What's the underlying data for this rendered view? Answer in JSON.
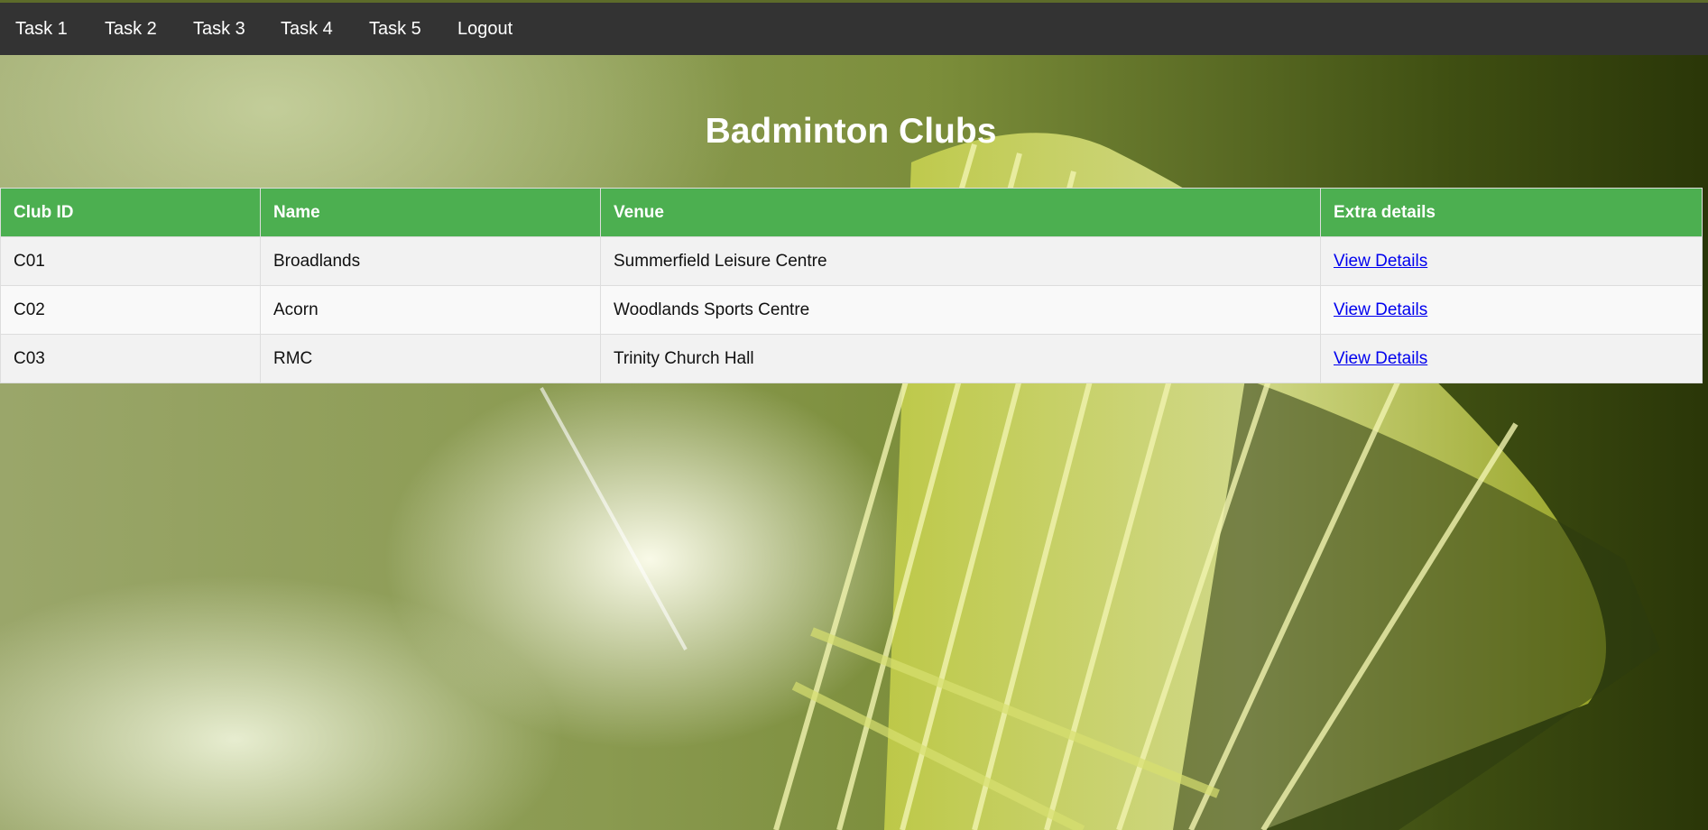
{
  "nav": {
    "items": [
      "Task 1",
      "Task 2",
      "Task 3",
      "Task 4",
      "Task 5",
      "Logout"
    ]
  },
  "page": {
    "title": "Badminton Clubs"
  },
  "table": {
    "headers": [
      "Club ID",
      "Name",
      "Venue",
      "Extra details"
    ],
    "rows": [
      {
        "id": "C01",
        "name": "Broadlands",
        "venue": "Summerfield Leisure Centre",
        "link": "View Details"
      },
      {
        "id": "C02",
        "name": "Acorn",
        "venue": "Woodlands Sports Centre",
        "link": "View Details"
      },
      {
        "id": "C03",
        "name": "RMC",
        "venue": "Trinity Church Hall",
        "link": "View Details"
      }
    ]
  },
  "colors": {
    "nav_bg": "#333333",
    "header_bg": "#4caf50",
    "link": "#0000ee"
  }
}
